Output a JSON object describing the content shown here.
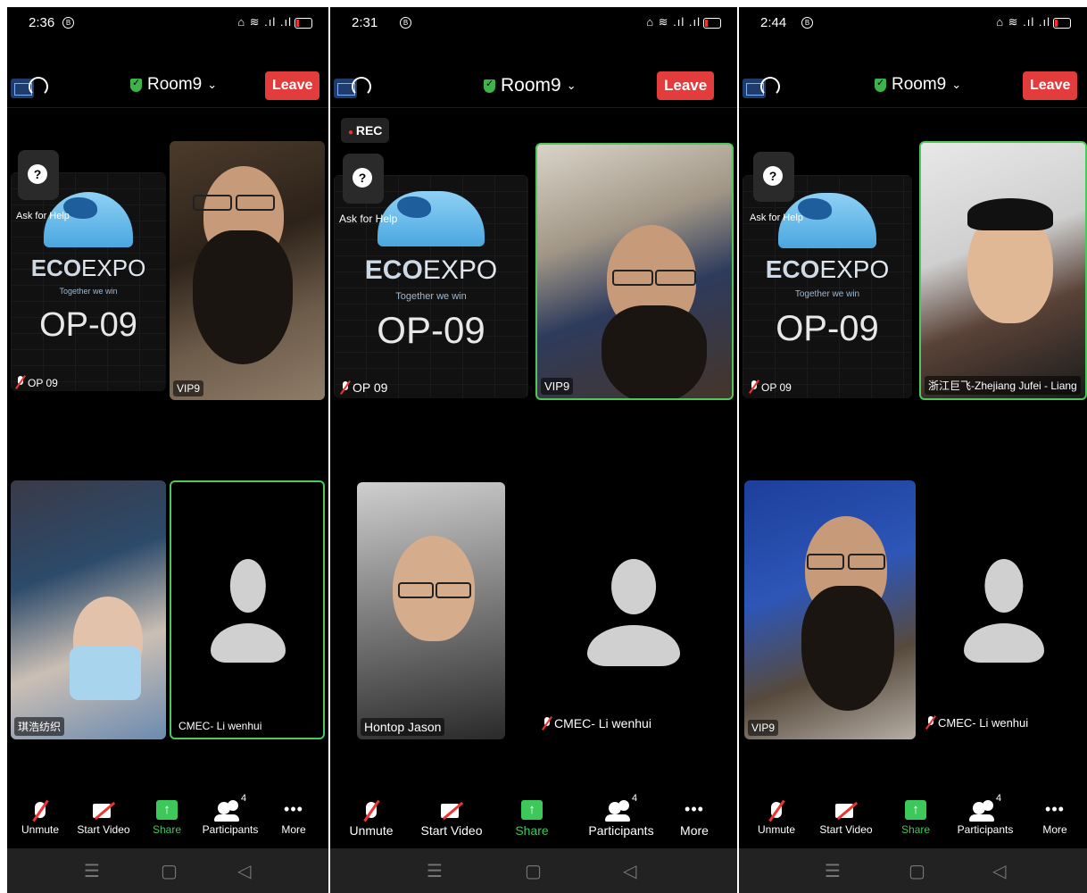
{
  "room": {
    "name": "Room9",
    "leave_label": "Leave",
    "rec_label": "REC"
  },
  "help": {
    "icon_glyph": "?",
    "label": "Ask for Help"
  },
  "tile_card": {
    "brand": "ECOEXPO",
    "brand_left": "ECO",
    "brand_right": "EXPO",
    "slogan": "Together we win",
    "code": "OP-09"
  },
  "participants": {
    "op": "OP 09",
    "vip": "VIP9",
    "li": "CMEC- Li wenhui",
    "qi": "琪浩纺织",
    "jason": "Hontop Jason",
    "liang": "浙江巨飞-Zhejiang Jufei - Liang"
  },
  "toolbar": {
    "unmute": "Unmute",
    "start_video": "Start Video",
    "share": "Share",
    "participants": "Participants",
    "participants_count": "4",
    "more": "More"
  },
  "phones": [
    {
      "time": "2:36",
      "status_icon": "B"
    },
    {
      "time": "2:31",
      "status_icon": "B"
    },
    {
      "time": "2:44",
      "status_icon": "B"
    }
  ],
  "status_icons": "⌂ ≋ .ıl .ıl",
  "nav": {
    "menu": "☰",
    "home": "▢",
    "back": "◁"
  },
  "colors": {
    "leave": "#e23c3c",
    "active_border": "#4cc85c",
    "share": "#3cc95a"
  }
}
